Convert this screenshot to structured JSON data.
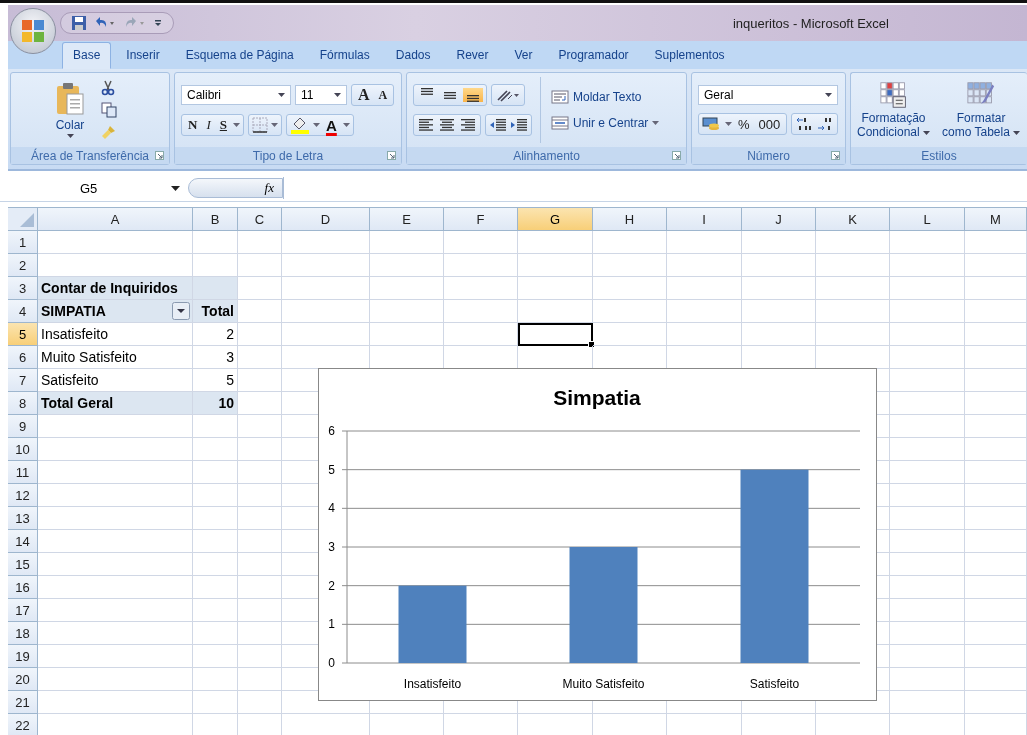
{
  "window": {
    "title": "inqueritos - Microsoft Excel"
  },
  "tabs": [
    {
      "label": "Base",
      "selected": true
    },
    {
      "label": "Inserir",
      "selected": false
    },
    {
      "label": "Esquema de Página",
      "selected": false
    },
    {
      "label": "Fórmulas",
      "selected": false
    },
    {
      "label": "Dados",
      "selected": false
    },
    {
      "label": "Rever",
      "selected": false
    },
    {
      "label": "Ver",
      "selected": false
    },
    {
      "label": "Programador",
      "selected": false
    },
    {
      "label": "Suplementos",
      "selected": false
    }
  ],
  "ribbon": {
    "clipboard": {
      "label": "Área de Transferência",
      "paste": "Colar"
    },
    "font": {
      "label": "Tipo de Letra",
      "font_name": "Calibri",
      "font_size": "11",
      "grow": "A",
      "shrink": "A",
      "bold": "N",
      "italic": "I",
      "underline": "S",
      "font_color": "A"
    },
    "alignment": {
      "label": "Alinhamento",
      "vertical_align": [
        {
          "selected": false
        },
        {
          "selected": false
        },
        {
          "selected": true
        }
      ],
      "wrap_text": "Moldar Texto",
      "merge": "Unir e Centrar"
    },
    "number": {
      "label": "Número",
      "format": "Geral",
      "percent": "%",
      "thousands": "000"
    },
    "styles": {
      "label": "Estilos",
      "buttons": [
        {
          "line1": "Formatação",
          "line2": "Condicional"
        },
        {
          "line1": "Formatar",
          "line2": "como Tabela"
        }
      ]
    }
  },
  "formula_bar": {
    "name_box": "G5",
    "function_label": "fx"
  },
  "sheet": {
    "columns": [
      {
        "label": "A",
        "selected": false
      },
      {
        "label": "B",
        "selected": false
      },
      {
        "label": "C",
        "selected": false
      },
      {
        "label": "D",
        "selected": false
      },
      {
        "label": "E",
        "selected": false
      },
      {
        "label": "F",
        "selected": false
      },
      {
        "label": "G",
        "selected": true
      },
      {
        "label": "H",
        "selected": false
      },
      {
        "label": "I",
        "selected": false
      },
      {
        "label": "J",
        "selected": false
      },
      {
        "label": "K",
        "selected": false
      },
      {
        "label": "L",
        "selected": false
      },
      {
        "label": "M",
        "selected": false
      }
    ],
    "rows": [
      {
        "label": "1",
        "selected": false
      },
      {
        "label": "2",
        "selected": false
      },
      {
        "label": "3",
        "selected": false
      },
      {
        "label": "4",
        "selected": false
      },
      {
        "label": "5",
        "selected": true
      },
      {
        "label": "6",
        "selected": false
      },
      {
        "label": "7",
        "selected": false
      },
      {
        "label": "8",
        "selected": false
      },
      {
        "label": "9",
        "selected": false
      },
      {
        "label": "10",
        "selected": false
      },
      {
        "label": "11",
        "selected": false
      },
      {
        "label": "12",
        "selected": false
      },
      {
        "label": "13",
        "selected": false
      },
      {
        "label": "14",
        "selected": false
      },
      {
        "label": "15",
        "selected": false
      },
      {
        "label": "16",
        "selected": false
      },
      {
        "label": "17",
        "selected": false
      },
      {
        "label": "18",
        "selected": false
      },
      {
        "label": "19",
        "selected": false
      },
      {
        "label": "20",
        "selected": false
      },
      {
        "label": "21",
        "selected": false
      },
      {
        "label": "22",
        "selected": false
      }
    ],
    "pivot_table": {
      "title": "Contar de Inquiridos",
      "header": [
        "SIMPATIA",
        "Total"
      ],
      "rows": [
        {
          "label": "Insatisfeito",
          "value": "2"
        },
        {
          "label": "Muito Satisfeito",
          "value": "3"
        },
        {
          "label": "Satisfeito",
          "value": "5"
        }
      ],
      "total": {
        "label": "Total Geral",
        "value": "10"
      }
    },
    "chart": {
      "chart_data": {
        "type": "bar",
        "title": "Simpatia",
        "categories": [
          "Insatisfeito",
          "Muito Satisfeito",
          "Satisfeito"
        ],
        "values": [
          2,
          3,
          5
        ],
        "grid": true,
        "ylim": [
          0,
          6
        ],
        "yticks": [
          0,
          1,
          2,
          3,
          4,
          5,
          6
        ]
      }
    }
  }
}
